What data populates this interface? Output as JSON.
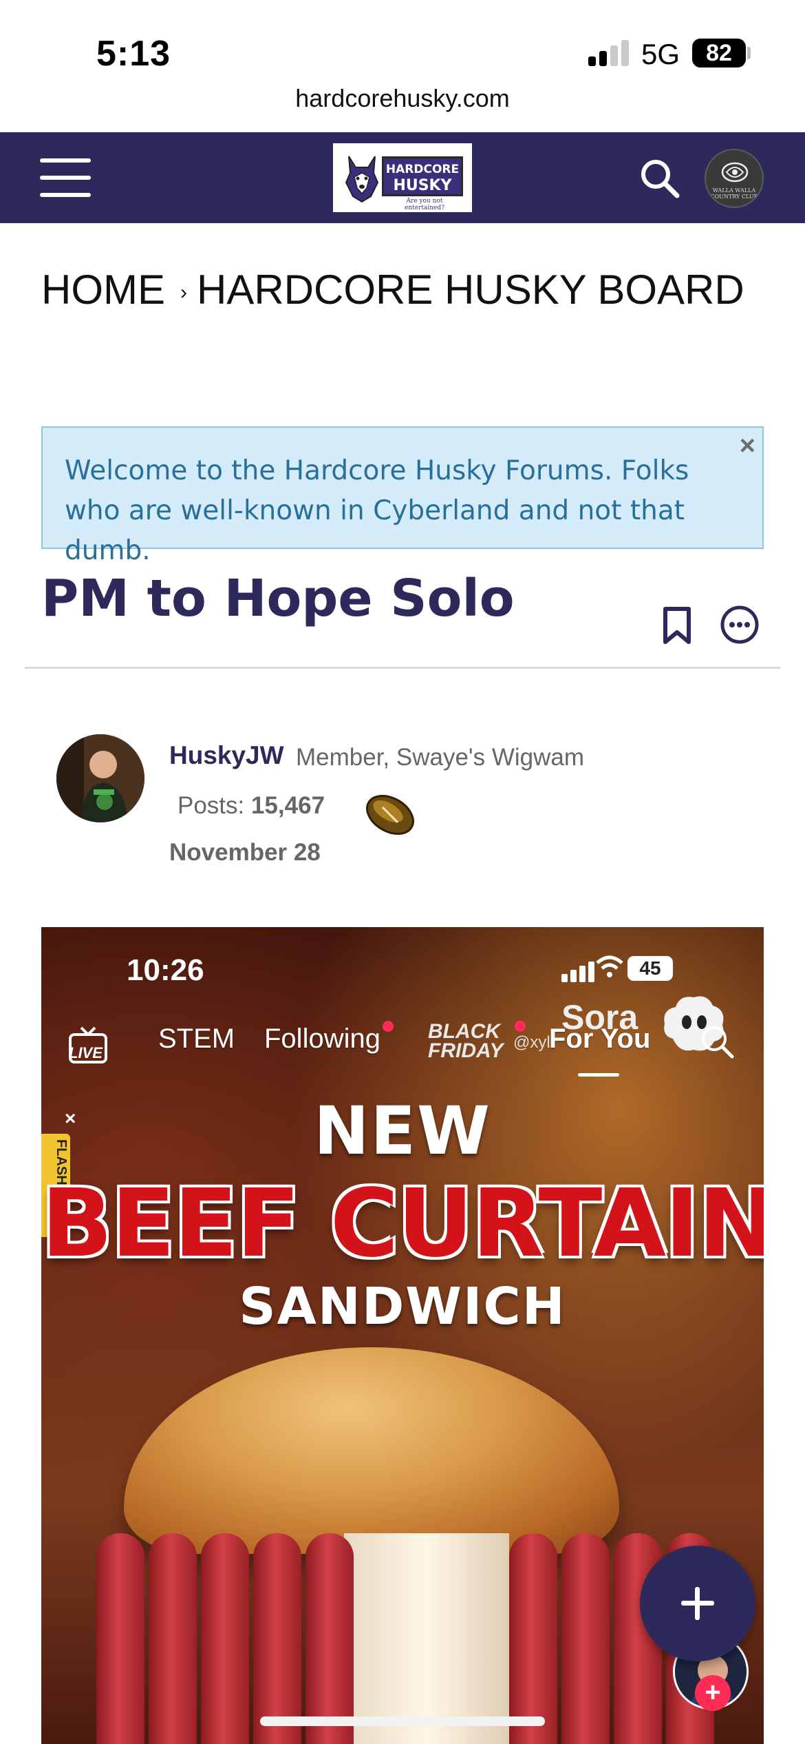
{
  "status_bar": {
    "time": "5:13",
    "network": "5G",
    "battery": "82"
  },
  "browser": {
    "url": "hardcorehusky.com"
  },
  "header": {
    "logo_line1": "HARDCORE",
    "logo_line2": "HUSKY",
    "logo_tagline": "Are you not entertained?",
    "club_avatar_text": "WALLA WALLA COUNTRY CLUB",
    "colors": {
      "nav_bg": "#2d2a5b",
      "accent": "#2d2a5b"
    }
  },
  "breadcrumb": {
    "home": "HOME",
    "separator": "›",
    "current": "HARDCORE HUSKY BOARD"
  },
  "welcome_banner": {
    "text": "Welcome to the Hardcore Husky Forums. Folks who are well-known in Cyberland and not that dumb.",
    "close": "×"
  },
  "thread": {
    "title": "PM to Hope Solo"
  },
  "post": {
    "author": "HuskyJW",
    "role": "Member, Swaye's Wigwam",
    "posts_label": "Posts:",
    "posts_count": "15,467",
    "date": "November 28",
    "badge_icon": "football-icon"
  },
  "embedded_image": {
    "time": "10:26",
    "battery": "45",
    "live_label": "LIVE",
    "tabs": [
      "STEM",
      "Following",
      "For You"
    ],
    "black_friday": "BLACK FRIDAY",
    "handle": "@xyl",
    "sora": "Sora",
    "flash_deals": "FLASH DEALS",
    "flash_close": "×",
    "headline_top": "NEW",
    "headline_main": "BEEF CURTAIN",
    "headline_sub": "SANDWICH",
    "follow_plus": "+"
  }
}
